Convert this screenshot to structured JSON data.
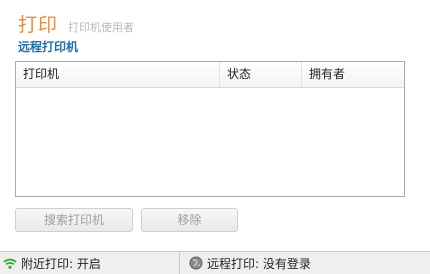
{
  "header": {
    "title": "打印",
    "users_tab": "打印机使用者"
  },
  "section": {
    "title": "远程打印机"
  },
  "list": {
    "columns": [
      "打印机",
      "状态",
      "拥有者"
    ],
    "rows": []
  },
  "buttons": {
    "search": "搜索打印机",
    "remove": "移除"
  },
  "status": {
    "nearby": "附近打印: 开启",
    "remote": "远程打印: 没有登录"
  },
  "colors": {
    "title": "#f08a32",
    "section_title": "#1e6fa8",
    "wifi_icon": "#2fae2f",
    "globe_icon": "#6f6f6f"
  },
  "icons": {
    "nearby": "wifi-icon",
    "remote": "globe-icon"
  }
}
